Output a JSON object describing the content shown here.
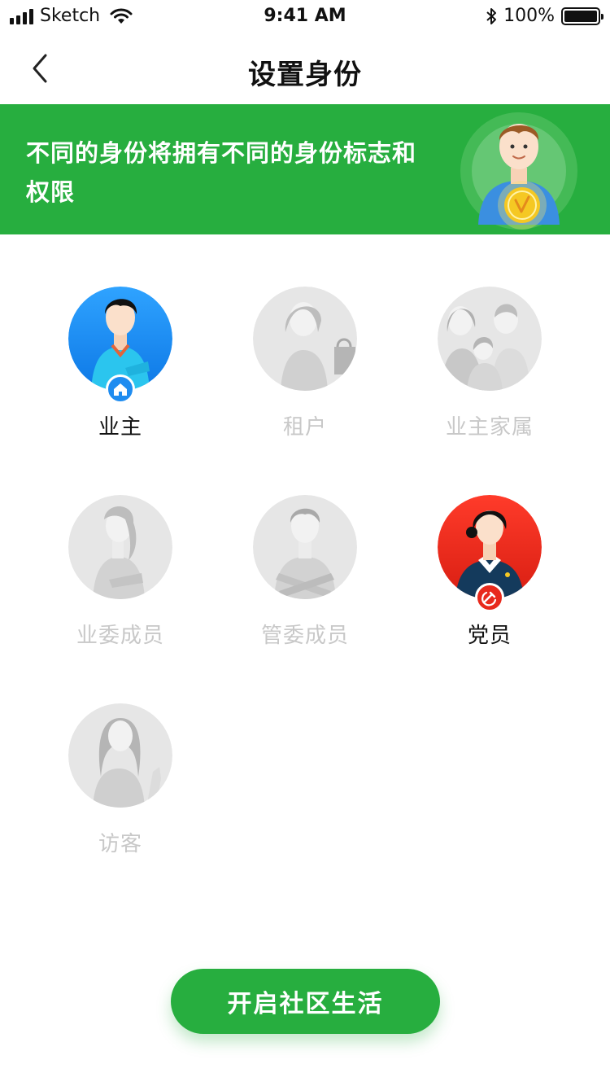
{
  "status_bar": {
    "carrier": "Sketch",
    "time": "9:41 AM",
    "battery": "100%",
    "icons": [
      "signal-icon",
      "wifi-icon",
      "bluetooth-icon",
      "battery-icon"
    ]
  },
  "nav": {
    "title": "设置身份",
    "back_icon": "chevron-left-icon"
  },
  "banner": {
    "text": "不同的身份将拥有不同的身份标志和权限",
    "background": "#27ae3f"
  },
  "roles": [
    {
      "label": "业主",
      "state": "selected",
      "badge": "home-icon"
    },
    {
      "label": "租户",
      "state": "unselected"
    },
    {
      "label": "业主家属",
      "state": "unselected"
    },
    {
      "label": "业委成员",
      "state": "unselected"
    },
    {
      "label": "管委成员",
      "state": "unselected"
    },
    {
      "label": "党员",
      "state": "selected",
      "badge": "party-emblem-icon"
    },
    {
      "label": "访客",
      "state": "unselected"
    }
  ],
  "cta": {
    "label": "开启社区生活"
  },
  "colors": {
    "accent_green": "#27ae3f",
    "owner_blue": "#1e8cf0",
    "party_red": "#e8291c",
    "inactive_gray": "#c8c8c8"
  }
}
